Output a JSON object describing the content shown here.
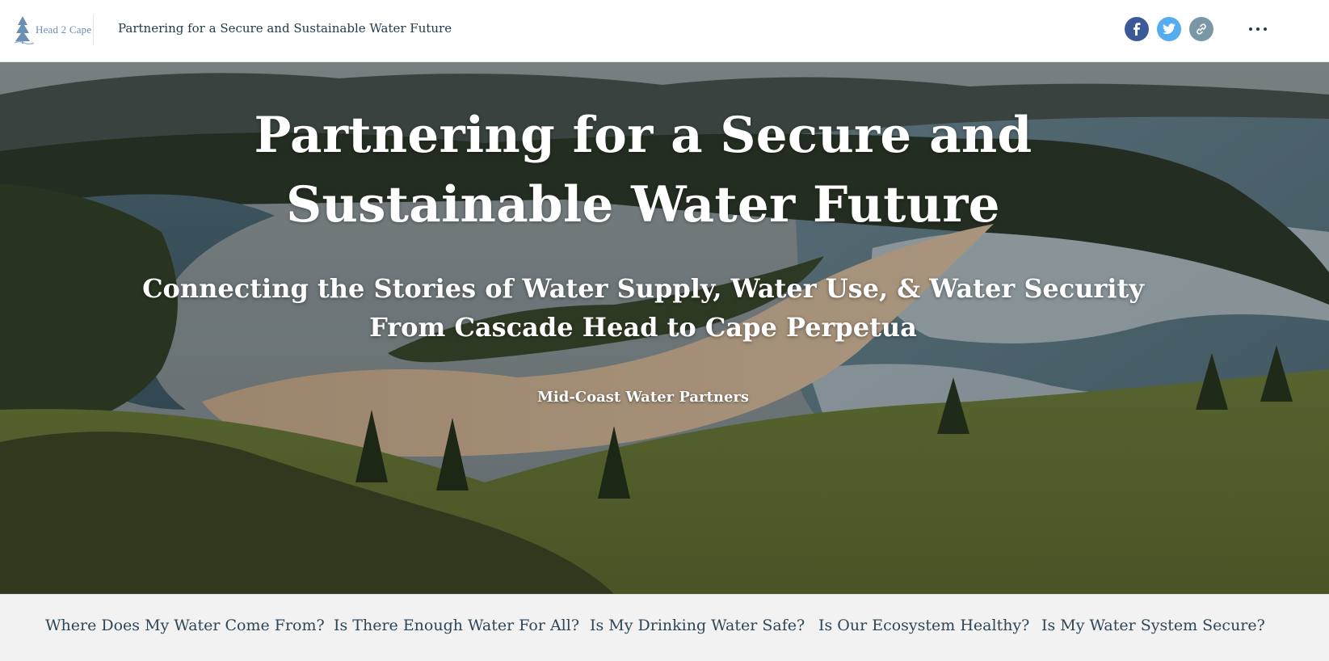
{
  "header": {
    "logo_text": "Head 2 Cape",
    "title": "Partnering for a Secure and Sustainable Water Future",
    "share": [
      {
        "name": "facebook-share-button",
        "icon": "facebook-icon",
        "color": "#3b5998"
      },
      {
        "name": "twitter-share-button",
        "icon": "twitter-icon",
        "color": "#55acee"
      },
      {
        "name": "copy-link-button",
        "icon": "link-icon",
        "color": "#7a97a6"
      }
    ],
    "more_icon": "more-horizontal-icon"
  },
  "hero": {
    "title": "Partnering for a Secure and Sustainable Water Future",
    "subtitle": "Connecting the Stories of Water Supply, Water Use, & Water Security From Cascade Head to Cape Perpetua",
    "byline": "Mid-Coast Water Partners"
  },
  "nav": {
    "items": [
      {
        "label": "Where Does My Water Come From?"
      },
      {
        "label": "Is There Enough Water For All?"
      },
      {
        "label": "Is My Drinking Water Safe?"
      },
      {
        "label": "Is Our Ecosystem Healthy?"
      },
      {
        "label": "Is My Water System Secure?"
      }
    ]
  },
  "colors": {
    "nav_background": "#f2f2f2",
    "nav_text": "#2f4657",
    "header_text": "#1f3a4a"
  }
}
